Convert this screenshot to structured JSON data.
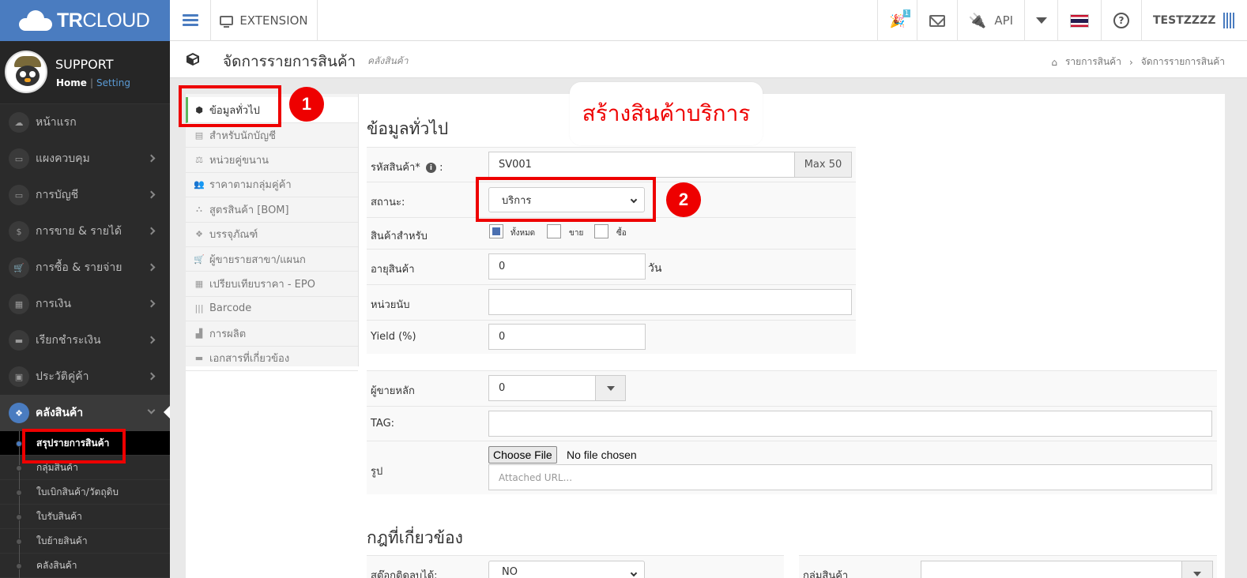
{
  "brand": {
    "bold": "TR",
    "light": "CLOUD"
  },
  "topbar": {
    "extension_label": "EXTENSION",
    "party_badge": "1",
    "api_label": "API",
    "username": "TESTZZZZ"
  },
  "profile": {
    "name": "SUPPORT",
    "home": "Home",
    "sep": "|",
    "setting": "Setting"
  },
  "sidebar": {
    "items": [
      {
        "label": "หน้าแรก",
        "icon": "☁"
      },
      {
        "label": "แผงควบคุม",
        "icon": "▭"
      },
      {
        "label": "การบัญชี",
        "icon": "▭"
      },
      {
        "label": "การขาย & รายได้",
        "icon": "$"
      },
      {
        "label": "การซื้อ & รายจ่าย",
        "icon": "🛒"
      },
      {
        "label": "การเงิน",
        "icon": "▦"
      },
      {
        "label": "เรียกชำระเงิน",
        "icon": "▬"
      },
      {
        "label": "ประวัติคู่ค้า",
        "icon": "▣"
      }
    ],
    "active": {
      "label": "คลังสินค้า",
      "icon": "❖"
    },
    "subitems": [
      "สรุปรายการสินค้า",
      "กลุ่มสินค้า",
      "ใบเบิกสินค้า/วัตถุดิบ",
      "ใบรับสินค้า",
      "ใบย้ายสินค้า",
      "คลังสินค้า"
    ]
  },
  "pagehead": {
    "title": "จัดการรายการสินค้า",
    "subtitle": "คลังสินค้า",
    "breadcrumb": [
      "รายการสินค้า",
      "›",
      "จัดการรายการสินค้า"
    ]
  },
  "tabs": [
    {
      "label": "ข้อมูลทั่วไป",
      "icon": "⬢"
    },
    {
      "label": "สำหรับนักบัญชี",
      "icon": "▤"
    },
    {
      "label": "หน่วยคู่ขนาน",
      "icon": "⚖"
    },
    {
      "label": "ราคาตามกลุ่มคู่ค้า",
      "icon": "👥"
    },
    {
      "label": "สูตรสินค้า [BOM]",
      "icon": "⛬"
    },
    {
      "label": "บรรจุภัณฑ์",
      "icon": "❖"
    },
    {
      "label": "ผู้ขายรายสาขา/แผนก",
      "icon": "🛒"
    },
    {
      "label": "เปรียบเทียบราคา - EPO",
      "icon": "▦"
    },
    {
      "label": "Barcode",
      "icon": "|||"
    },
    {
      "label": "การผลิต",
      "icon": "▟"
    },
    {
      "label": "เอกสารที่เกี่ยวข้อง",
      "icon": "▬"
    }
  ],
  "form": {
    "section_title": "ข้อมูลทั่วไป",
    "code_label": "รหัสสินค้า*",
    "code_info": "i",
    "code_colon": ":",
    "code_value": "SV001",
    "code_max": "Max 50",
    "status_label": "สถานะ:",
    "status_value": "บริการ",
    "for_label": "สินค้าสำหรับ",
    "for_all": "ทั้งหมด",
    "for_sell": "ขาย",
    "for_buy": "ซื้อ",
    "age_label": "อายุสินค้า",
    "age_value": "0",
    "age_unit": "วัน",
    "unit_label": "หน่วยนับ",
    "unit_value": "",
    "yield_label": "Yield (%)",
    "yield_value": "0",
    "vendor_label": "ผู้ขายหลัก",
    "vendor_value": "0",
    "tag_label": "TAG:",
    "tag_value": "",
    "image_label": "รูป",
    "choose_file": "Choose File",
    "no_file": "No file chosen",
    "attached_placeholder": "Attached URL...",
    "rules_title": "กฎที่เกี่ยวข้อง",
    "stock_label": "สต๊อกติดลบได้:",
    "stock_value": "NO",
    "group_label": "กลุ่มสินค้า"
  },
  "annotations": {
    "step1": "1",
    "step2": "2",
    "callout": "สร้างสินค้าบริการ"
  },
  "colors": {
    "brand_blue": "#4a7cc0",
    "annotation_red": "#ee0000",
    "active_tab_green": "#5cb85c"
  }
}
